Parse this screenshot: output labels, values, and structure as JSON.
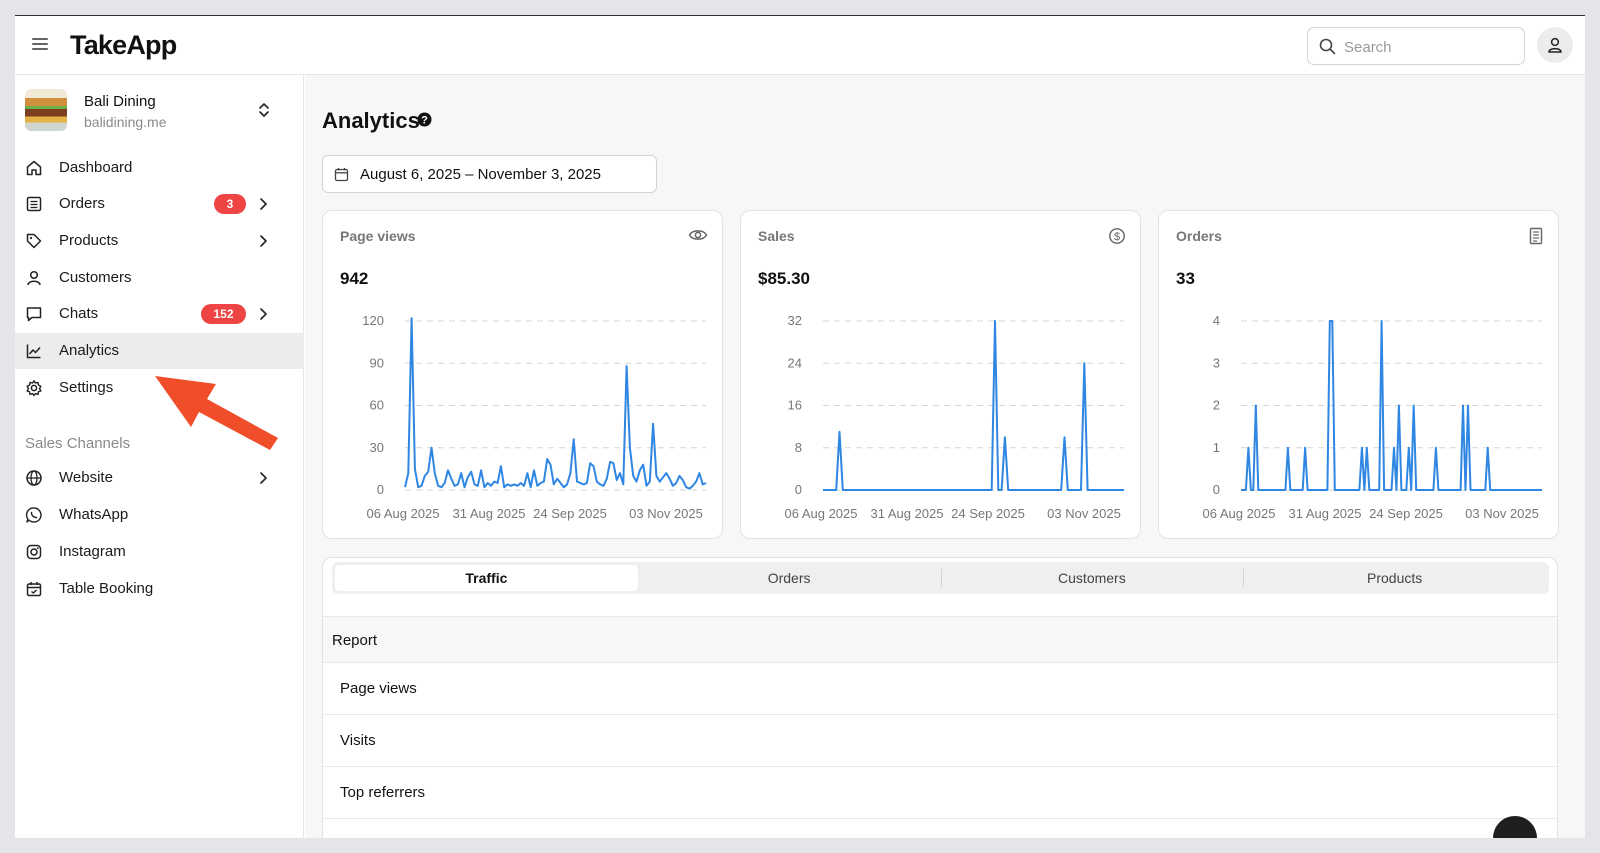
{
  "app": {
    "brand": "TakeApp"
  },
  "search": {
    "placeholder": "Search"
  },
  "store": {
    "name": "Bali Dining",
    "url": "balidining.me"
  },
  "sidebar": {
    "items": [
      {
        "label": "Dashboard",
        "icon": "home-icon"
      },
      {
        "label": "Orders",
        "icon": "orders-icon",
        "badge": "3"
      },
      {
        "label": "Products",
        "icon": "tag-icon"
      },
      {
        "label": "Customers",
        "icon": "user-icon"
      },
      {
        "label": "Chats",
        "icon": "chat-icon",
        "badge": "152"
      },
      {
        "label": "Analytics",
        "icon": "line-chart-icon",
        "active": true
      },
      {
        "label": "Settings",
        "icon": "gear-icon"
      }
    ],
    "channels_label": "Sales Channels",
    "channels": [
      {
        "label": "Website",
        "icon": "globe-icon"
      },
      {
        "label": "WhatsApp",
        "icon": "whatsapp-icon"
      },
      {
        "label": "Instagram",
        "icon": "instagram-icon"
      },
      {
        "label": "Table Booking",
        "icon": "calendar-check-icon"
      }
    ]
  },
  "main": {
    "title": "Analytics",
    "date_range": "August 6, 2025 – November 3, 2025"
  },
  "colors": {
    "accent": "#2f86e3",
    "badge": "#ef4444",
    "arrow": "#f04e2a"
  },
  "chart_data": [
    {
      "type": "line",
      "title": "Page views",
      "total": "942",
      "x_ticks": [
        "06 Aug 2025",
        "31 Aug 2025",
        "24 Sep 2025",
        "03 Nov 2025"
      ],
      "yticks": [
        0,
        30,
        60,
        90,
        120
      ],
      "ylim": [
        0,
        120
      ],
      "grid": true,
      "values": [
        2,
        12,
        122,
        15,
        2,
        3,
        10,
        13,
        30,
        12,
        3,
        2,
        5,
        14,
        8,
        3,
        4,
        12,
        2,
        9,
        13,
        4,
        3,
        14,
        2,
        5,
        3,
        6,
        5,
        17,
        2,
        4,
        3,
        4,
        3,
        5,
        3,
        12,
        2,
        14,
        3,
        5,
        6,
        22,
        18,
        4,
        8,
        5,
        2,
        4,
        12,
        36,
        6,
        5,
        4,
        5,
        19,
        17,
        6,
        4,
        3,
        8,
        20,
        19,
        7,
        12,
        4,
        88,
        30,
        10,
        6,
        14,
        18,
        3,
        6,
        47,
        10,
        6,
        9,
        12,
        8,
        3,
        5,
        10,
        7,
        2,
        1,
        3,
        6,
        12,
        4,
        5
      ]
    },
    {
      "type": "line",
      "title": "Sales",
      "total": "$85.30",
      "x_ticks": [
        "06 Aug 2025",
        "31 Aug 2025",
        "24 Sep 2025",
        "03 Nov 2025"
      ],
      "yticks": [
        0,
        8,
        16,
        24,
        32
      ],
      "ylim": [
        0,
        32
      ],
      "grid": true,
      "values": [
        0,
        0,
        0,
        0,
        0,
        11,
        0,
        0,
        0,
        0,
        0,
        0,
        0,
        0,
        0,
        0,
        0,
        0,
        0,
        0,
        0,
        0,
        0,
        0,
        0,
        0,
        0,
        0,
        0,
        0,
        0,
        0,
        0,
        0,
        0,
        0,
        0,
        0,
        0,
        0,
        0,
        0,
        0,
        0,
        0,
        0,
        0,
        0,
        0,
        0,
        0,
        0,
        32,
        0,
        0,
        10,
        0,
        0,
        0,
        0,
        0,
        0,
        0,
        0,
        0,
        0,
        0,
        0,
        0,
        0,
        0,
        0,
        0,
        10,
        0,
        0,
        0,
        0,
        0,
        24,
        0,
        0,
        0,
        0,
        0,
        0,
        0,
        0,
        0,
        0,
        0,
        0
      ]
    },
    {
      "type": "line",
      "title": "Orders",
      "total": "33",
      "x_ticks": [
        "06 Aug 2025",
        "31 Aug 2025",
        "24 Sep 2025",
        "03 Nov 2025"
      ],
      "yticks": [
        0,
        1,
        2,
        3,
        4
      ],
      "ylim": [
        0,
        4
      ],
      "grid": true,
      "values": [
        0,
        0,
        0,
        1,
        0,
        0,
        2,
        0,
        0,
        0,
        0,
        0,
        0,
        0,
        0,
        0,
        0,
        0,
        0,
        1,
        0,
        0,
        0,
        0,
        0,
        0,
        1,
        0,
        0,
        0,
        0,
        0,
        0,
        0,
        0,
        0,
        4,
        4,
        0,
        0,
        0,
        0,
        0,
        0,
        0,
        0,
        0,
        0,
        0,
        1,
        0,
        1,
        0,
        0,
        0,
        0,
        0,
        4,
        0,
        0,
        0,
        0,
        1,
        0,
        2,
        0,
        0,
        0,
        1,
        0,
        2,
        0,
        0,
        0,
        0,
        0,
        0,
        0,
        0,
        1,
        0,
        0,
        0,
        0,
        0,
        0,
        0,
        0,
        0,
        0,
        2,
        0,
        2,
        0,
        0,
        0,
        0,
        0,
        0,
        0,
        1,
        0,
        0,
        0,
        0,
        0,
        0,
        0,
        0,
        0,
        0,
        0,
        0,
        0,
        0,
        0,
        0,
        0,
        0,
        0,
        0,
        0,
        0
      ]
    }
  ],
  "report": {
    "tabs": [
      "Traffic",
      "Orders",
      "Customers",
      "Products"
    ],
    "active_tab": "Traffic",
    "heading": "Report",
    "rows": [
      "Page views",
      "Visits",
      "Top referrers"
    ]
  }
}
